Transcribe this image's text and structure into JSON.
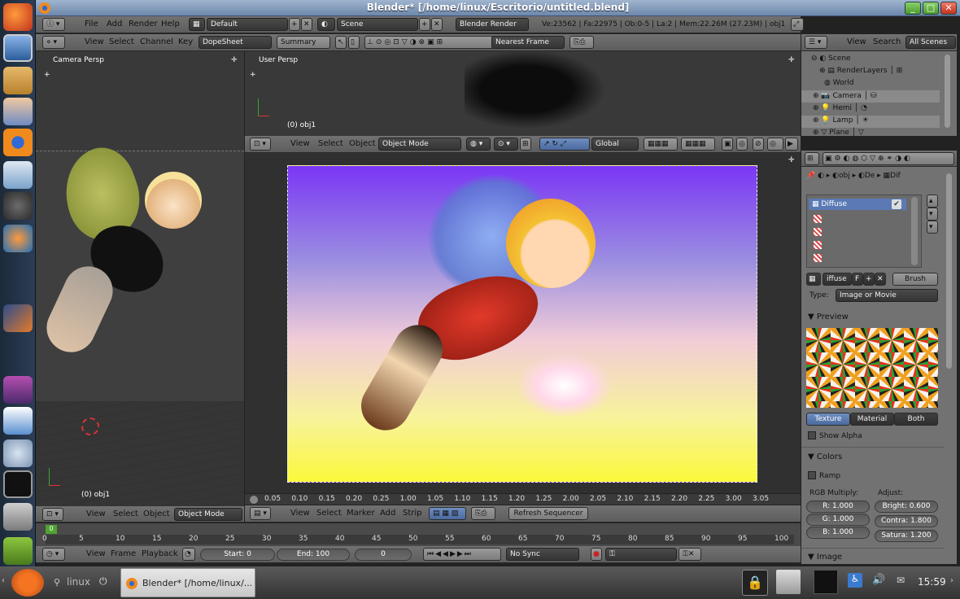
{
  "window": {
    "title": "Blender* [/home/linux/Escritorio/untitled.blend]",
    "min": "_",
    "max": "□",
    "close": "✕"
  },
  "info_header": {
    "menus": [
      "File",
      "Add",
      "Render",
      "Help"
    ],
    "screen_layout": "Default",
    "scene": "Scene",
    "engine": "Blender Render",
    "stats": "Ve:23562 | Fa:22975 | Ob:0-5 | La:2 | Mem:22.26M (27.23M) | obj1"
  },
  "dopesheet_header": {
    "menus": [
      "View",
      "Select",
      "Channel",
      "Key"
    ],
    "mode": "DopeSheet",
    "summary": "Summary",
    "snap": "Nearest Frame"
  },
  "camera_view": {
    "title": "Camera Persp",
    "object_label": "(0) obj1"
  },
  "user_view": {
    "title": "User Persp",
    "object_label": "(0) obj1"
  },
  "view3d_header": {
    "menus": [
      "View",
      "Select",
      "Object"
    ],
    "mode": "Object Mode",
    "orientation": "Global"
  },
  "left_header": {
    "menus": [
      "View",
      "Select",
      "Object"
    ],
    "mode": "Object Mode"
  },
  "sequencer": {
    "menus": [
      "View",
      "Select",
      "Marker",
      "Add",
      "Strip"
    ],
    "refresh": "Refresh Sequencer",
    "ruler": [
      "0.05",
      "0.10",
      "0.15",
      "0.20",
      "0.25",
      "1.00",
      "1.05",
      "1.10",
      "1.15",
      "1.20",
      "1.25",
      "2.00",
      "2.05",
      "2.10",
      "2.15",
      "2.20",
      "2.25",
      "3.00",
      "3.05"
    ]
  },
  "timeline": {
    "current_frame_marker": "0",
    "ruler": [
      "0",
      "5",
      "10",
      "15",
      "20",
      "25",
      "30",
      "35",
      "40",
      "45",
      "50",
      "55",
      "60",
      "65",
      "70",
      "75",
      "80",
      "85",
      "90",
      "95",
      "100"
    ],
    "menus": [
      "View",
      "Frame",
      "Playback"
    ],
    "start": "Start: 0",
    "end": "End: 100",
    "frame": "0",
    "sync": "No Sync"
  },
  "outliner": {
    "menus": [
      "View",
      "Search"
    ],
    "filter": "All Scenes",
    "items": [
      "Scene",
      "RenderLayers",
      "World",
      "Camera",
      "Hemi",
      "Lamp",
      "Plane"
    ]
  },
  "properties": {
    "breadcrumb": [
      "obj",
      "De",
      "Dif"
    ],
    "texture_slots": [
      "Diffuse"
    ],
    "texture_name": "iffuse",
    "f_label": "F",
    "brush": "Brush",
    "type_label": "Type:",
    "type_value": "Image or Movie",
    "preview_header": "Preview",
    "preview_tabs": [
      "Texture",
      "Material",
      "Both"
    ],
    "show_alpha": "Show Alpha",
    "colors_header": "Colors",
    "ramp": "Ramp",
    "rgb_multiply": "RGB Multiply:",
    "adjust": "Adjust:",
    "r": "R: 1.000",
    "g": "G: 1.000",
    "b": "B: 1.000",
    "bright": "Bright: 0.600",
    "contrast": "Contra: 1.800",
    "saturation": "Satura: 1.200",
    "image_header": "Image"
  },
  "taskbar": {
    "launcher": "linux",
    "task": "Blender* [/home/linux/...",
    "clock": "15:59"
  },
  "colors": {
    "accent_blue": "#5680c2",
    "selected_slot": "#5b7ab5",
    "timeline_green": "#4ea331"
  }
}
